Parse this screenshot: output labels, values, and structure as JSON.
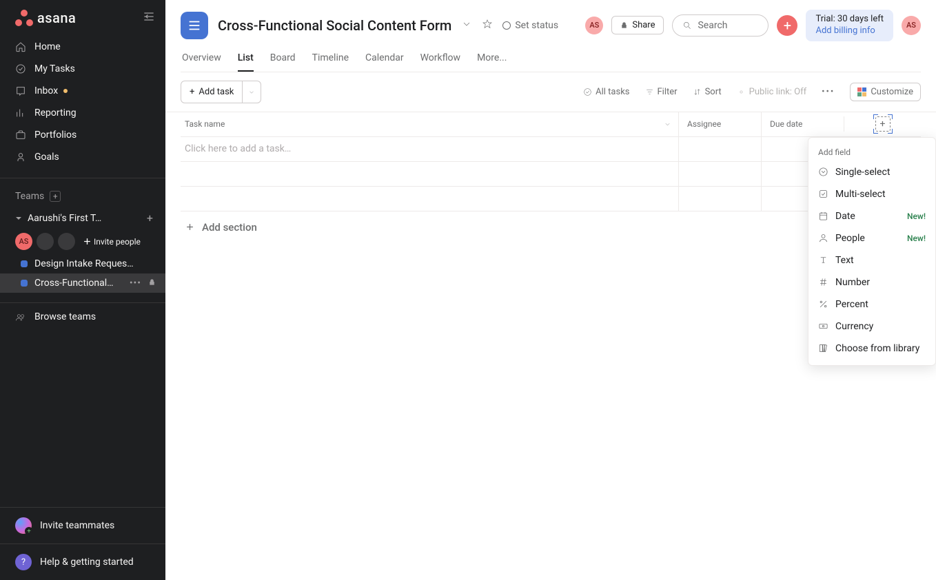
{
  "brand": "asana",
  "user_initials": "AS",
  "nav": {
    "home": "Home",
    "my_tasks": "My Tasks",
    "inbox": "Inbox",
    "reporting": "Reporting",
    "portfolios": "Portfolios",
    "goals": "Goals"
  },
  "teams_header": "Teams",
  "team": {
    "name": "Aarushi's First T…"
  },
  "invite_people": "Invite people",
  "projects": [
    {
      "name": "Design Intake Reques…",
      "color": "#4573d2",
      "selected": false
    },
    {
      "name": "Cross-Functional…",
      "color": "#4573d2",
      "selected": true
    }
  ],
  "browse_teams": "Browse teams",
  "invite_teammates": "Invite teammates",
  "help": "Help & getting started",
  "header": {
    "title": "Cross-Functional Social Content Form",
    "set_status": "Set status",
    "share": "Share",
    "search_placeholder": "Search",
    "trial_line1": "Trial: 30 days left",
    "trial_line2": "Add billing info"
  },
  "tabs": {
    "overview": "Overview",
    "list": "List",
    "board": "Board",
    "timeline": "Timeline",
    "calendar": "Calendar",
    "workflow": "Workflow",
    "more": "More..."
  },
  "toolbar": {
    "add_task": "Add task",
    "all_tasks": "All tasks",
    "filter": "Filter",
    "sort": "Sort",
    "public_link": "Public link: Off",
    "customize": "Customize"
  },
  "columns": {
    "task_name": "Task name",
    "assignee": "Assignee",
    "due_date": "Due date"
  },
  "placeholder_row": "Click here to add a task…",
  "add_section": "Add section",
  "popup": {
    "header": "Add field",
    "single": "Single-select",
    "multi": "Multi-select",
    "date": "Date",
    "people": "People",
    "text": "Text",
    "number": "Number",
    "percent": "Percent",
    "currency": "Currency",
    "library": "Choose from library",
    "new_badge": "New!"
  }
}
